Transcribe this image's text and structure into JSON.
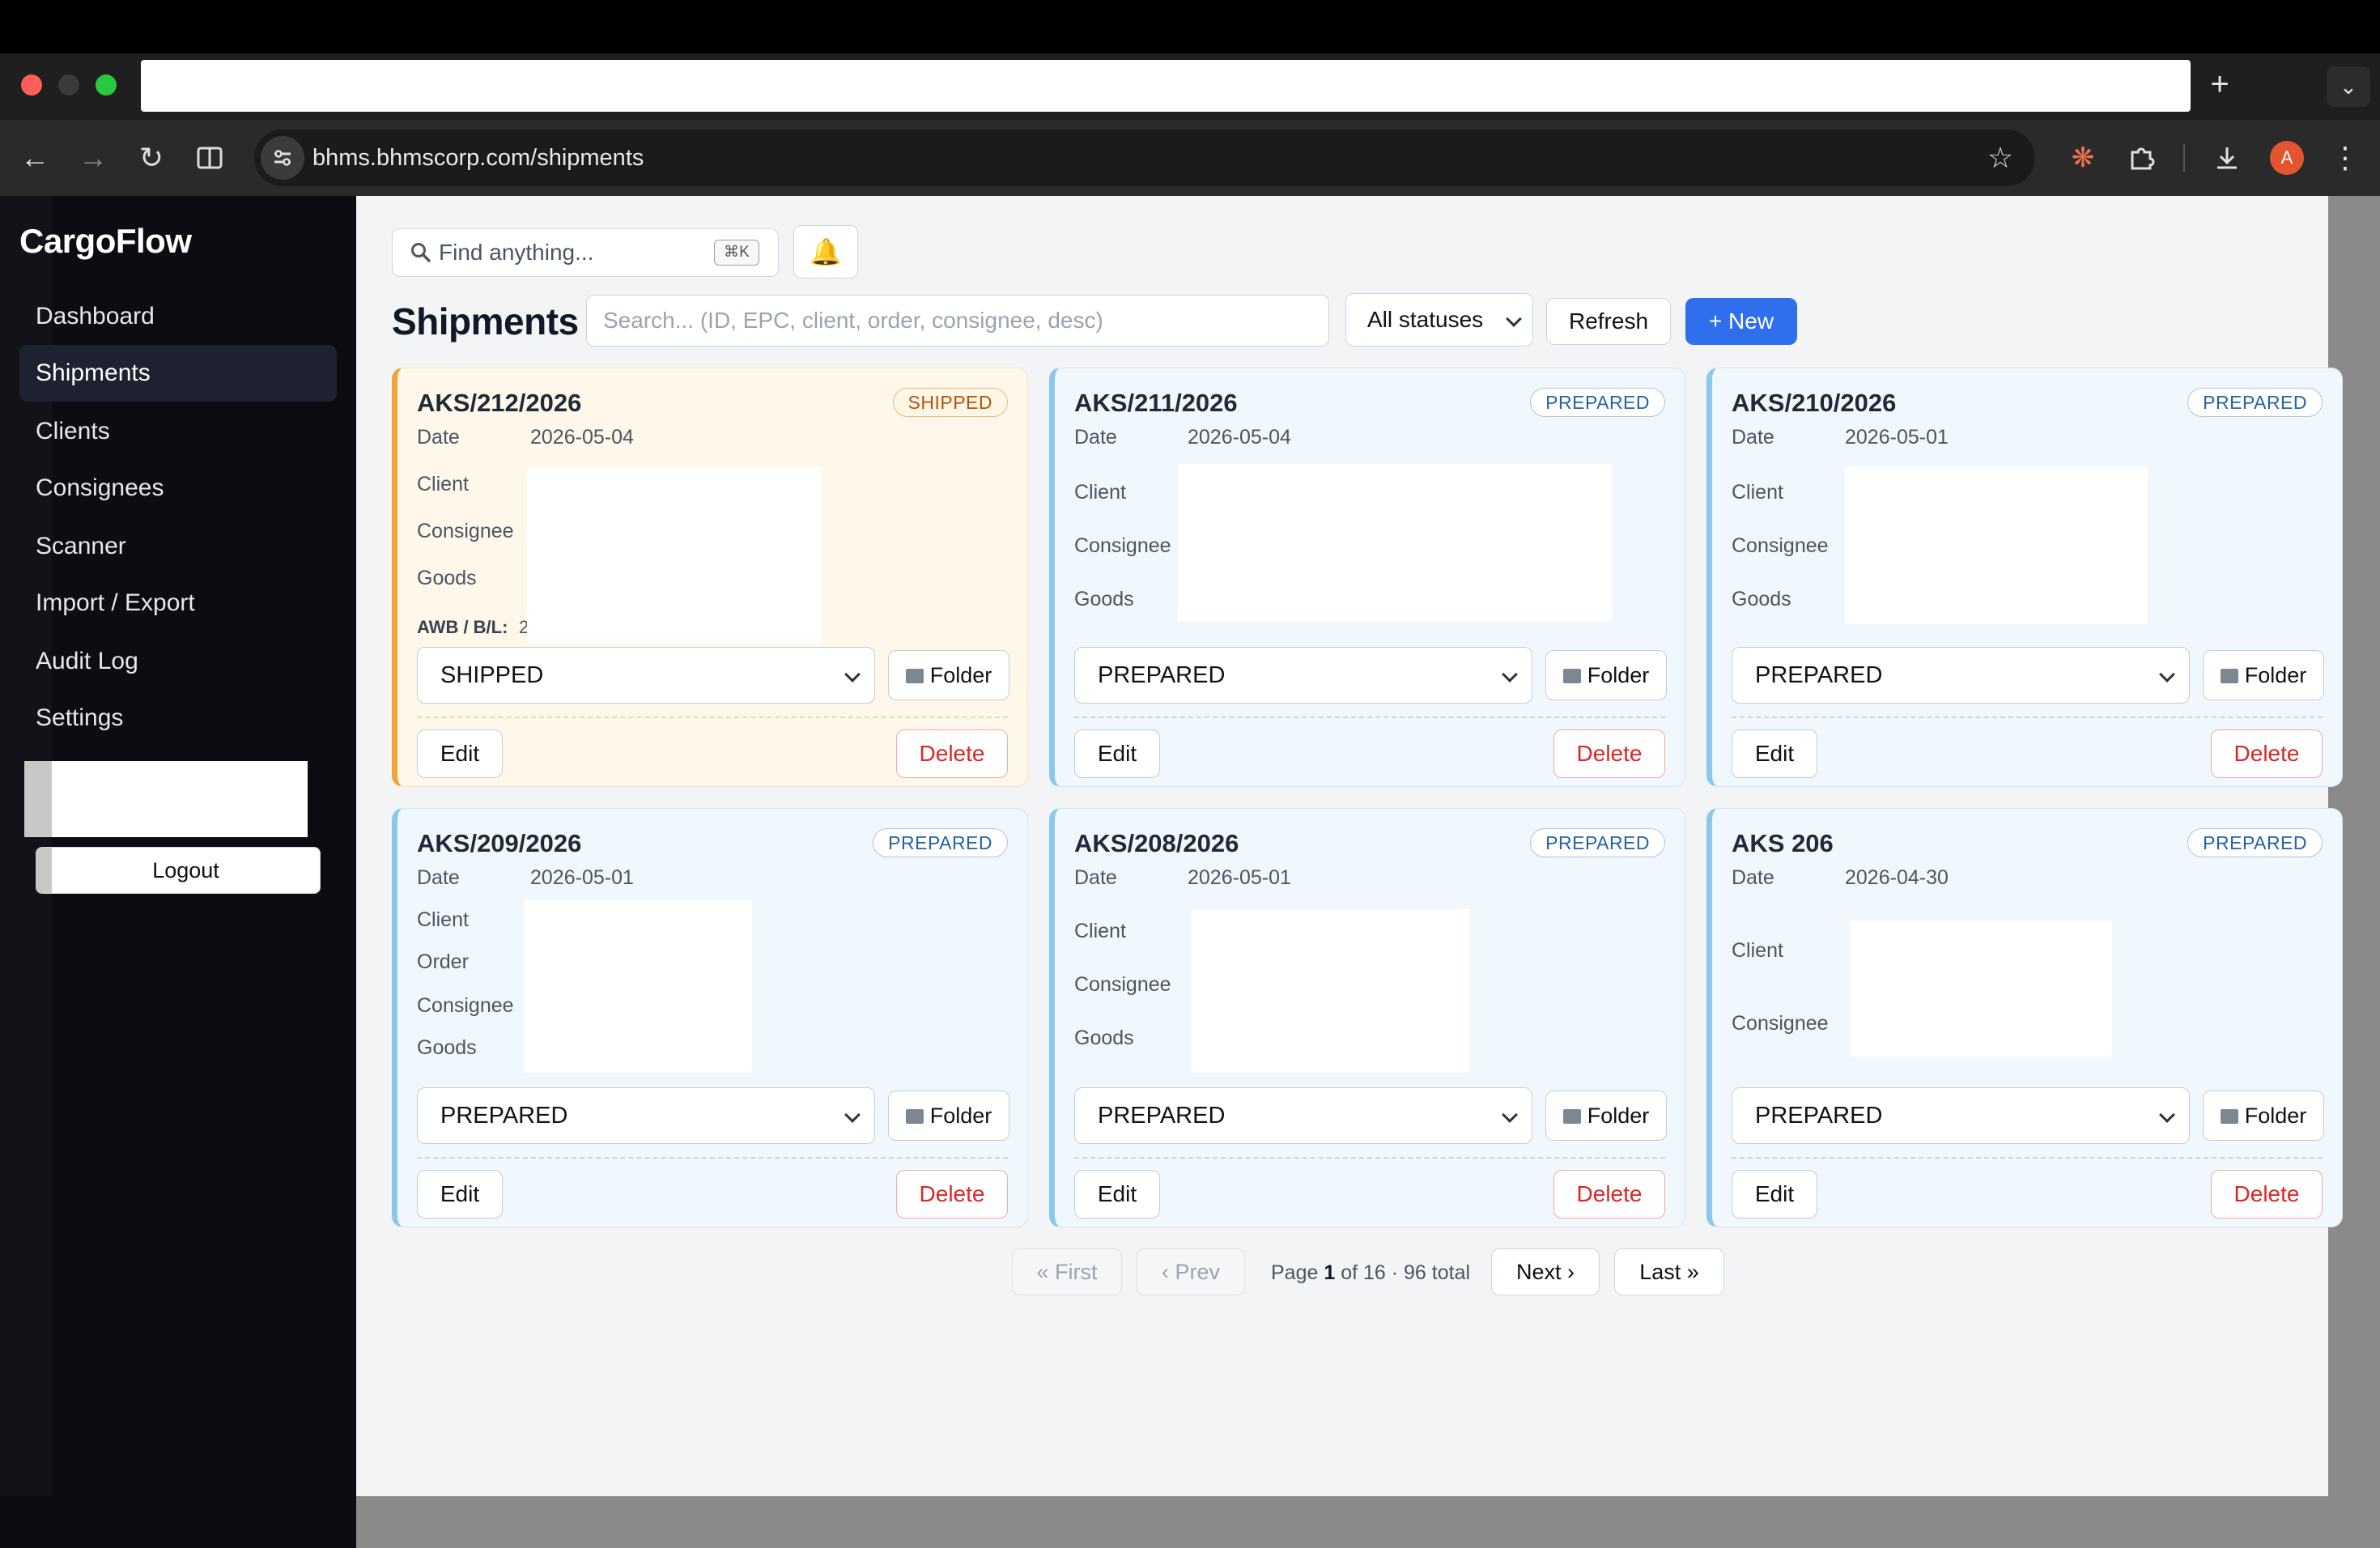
{
  "browser": {
    "url": "bhms.bhmscorp.com/shipments",
    "newtab_glyph": "+",
    "tabmenu_glyph": "⌄",
    "profile_initial": "A"
  },
  "app": {
    "brand": "CargoFlow",
    "nav": [
      {
        "label": "Dashboard",
        "active": false
      },
      {
        "label": "Shipments",
        "active": true
      },
      {
        "label": "Clients",
        "active": false
      },
      {
        "label": "Consignees",
        "active": false
      },
      {
        "label": "Scanner",
        "active": false
      },
      {
        "label": "Import / Export",
        "active": false
      },
      {
        "label": "Audit Log",
        "active": false
      },
      {
        "label": "Settings",
        "active": false
      }
    ],
    "logout_label": "Logout"
  },
  "topsearch": {
    "placeholder": "Find anything...",
    "shortcut": "⌘K"
  },
  "shipments": {
    "title": "Shipments",
    "search_placeholder": "Search... (ID, EPC, client, order, consignee, desc)",
    "status_filter": "All statuses",
    "refresh_label": "Refresh",
    "new_label": "+ New",
    "cards": [
      {
        "id": "AKS/212/2026",
        "badge": "SHIPPED",
        "date_label": "Date",
        "date": "2026-05-04",
        "fields": [
          "Client",
          "Consignee",
          "Goods"
        ],
        "awb_label": "AWB / B/L:",
        "awb_value": "2",
        "status": "SHIPPED",
        "folder_label": "Folder",
        "edit_label": "Edit",
        "delete_label": "Delete"
      },
      {
        "id": "AKS/211/2026",
        "badge": "PREPARED",
        "date_label": "Date",
        "date": "2026-05-04",
        "fields": [
          "Client",
          "Consignee",
          "Goods"
        ],
        "status": "PREPARED",
        "folder_label": "Folder",
        "edit_label": "Edit",
        "delete_label": "Delete"
      },
      {
        "id": "AKS/210/2026",
        "badge": "PREPARED",
        "date_label": "Date",
        "date": "2026-05-01",
        "fields": [
          "Client",
          "Consignee",
          "Goods"
        ],
        "status": "PREPARED",
        "folder_label": "Folder",
        "edit_label": "Edit",
        "delete_label": "Delete"
      },
      {
        "id": "AKS/209/2026",
        "badge": "PREPARED",
        "date_label": "Date",
        "date": "2026-05-01",
        "fields": [
          "Client",
          "Order",
          "Consignee",
          "Goods"
        ],
        "status": "PREPARED",
        "folder_label": "Folder",
        "edit_label": "Edit",
        "delete_label": "Delete"
      },
      {
        "id": "AKS/208/2026",
        "badge": "PREPARED",
        "date_label": "Date",
        "date": "2026-05-01",
        "fields": [
          "Client",
          "Consignee",
          "Goods"
        ],
        "status": "PREPARED",
        "folder_label": "Folder",
        "edit_label": "Edit",
        "delete_label": "Delete"
      },
      {
        "id": "AKS 206",
        "badge": "PREPARED",
        "date_label": "Date",
        "date": "2026-04-30",
        "fields": [
          "Client",
          "Consignee"
        ],
        "status": "PREPARED",
        "folder_label": "Folder",
        "edit_label": "Edit",
        "delete_label": "Delete"
      }
    ]
  },
  "pagination": {
    "first_label": "« First",
    "prev_label": "‹ Prev",
    "page_word": "Page",
    "current_page": "1",
    "of_text": "of 16 · 96 total",
    "next_label": "Next ›",
    "last_label": "Last »"
  }
}
